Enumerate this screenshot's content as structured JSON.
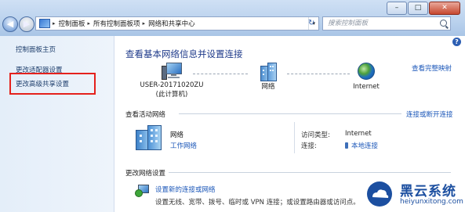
{
  "window": {
    "controls": {
      "minimize": "–",
      "maximize": "□",
      "close": "✕"
    }
  },
  "nav": {
    "back": "◀",
    "forward": "▶",
    "dropdown": "▾"
  },
  "addressbar": {
    "breadcrumbs": [
      "控制面板",
      "所有控制面板项",
      "网络和共享中心"
    ],
    "separator": "▸",
    "dropdown": "▾",
    "refresh": "↻"
  },
  "search": {
    "placeholder": "搜索控制面板"
  },
  "sidebar": {
    "items": [
      {
        "label": "控制面板主页"
      },
      {
        "label": "更改适配器设置"
      },
      {
        "label": "更改高级共享设置"
      }
    ]
  },
  "main": {
    "help": "?",
    "title": "查看基本网络信息并设置连接",
    "full_map_link": "查看完整映射",
    "map": {
      "computer": {
        "name": "USER-20171020ZU",
        "sub": "(此计算机)"
      },
      "network": {
        "name": "网络"
      },
      "internet": {
        "name": "Internet"
      }
    },
    "active": {
      "header": "查看活动网络",
      "connect_link": "连接或断开连接",
      "network_name": "网络",
      "network_type": "工作网络",
      "access_type_label": "访问类型:",
      "access_type_value": "Internet",
      "connection_label": "连接:",
      "connection_value": "本地连接"
    },
    "change": {
      "header": "更改网络设置",
      "setup_link": "设置新的连接或网络",
      "setup_desc": "设置无线、宽带、拨号、临时或 VPN 连接；或设置路由器或访问点。"
    }
  },
  "watermark": {
    "brand": "黑云系统",
    "url": "heiyunxitong.com"
  },
  "colors": {
    "accent": "#1a56b8",
    "title": "#1e3a8a",
    "highlight": "#e5211c",
    "sidebar_bg": "#e4eef9"
  }
}
